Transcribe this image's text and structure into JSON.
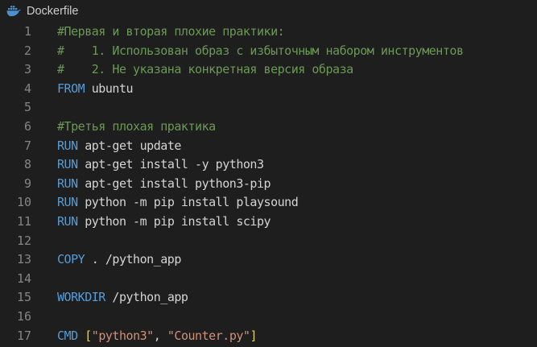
{
  "tab": {
    "filename": "Dockerfile",
    "icon": "docker-icon",
    "icon_color": "#4c8fca"
  },
  "colors": {
    "background": "#1e1e1e",
    "line_number": "#858585",
    "comment": "#6a9955",
    "keyword": "#569cd6",
    "text": "#d4d4d4",
    "string": "#ce9178",
    "bracket": "#ffd700"
  },
  "lines": [
    {
      "number": "1",
      "tokens": [
        {
          "type": "comment",
          "text": "#Первая и вторая плохие практики:"
        }
      ]
    },
    {
      "number": "2",
      "tokens": [
        {
          "type": "comment",
          "text": "#    1. Использован образ с избыточным набором инструментов"
        }
      ]
    },
    {
      "number": "3",
      "tokens": [
        {
          "type": "comment",
          "text": "#    2. Не указана конкретная версия образа"
        }
      ]
    },
    {
      "number": "4",
      "tokens": [
        {
          "type": "keyword",
          "text": "FROM"
        },
        {
          "type": "plain",
          "text": " ubuntu"
        }
      ]
    },
    {
      "number": "5",
      "tokens": []
    },
    {
      "number": "6",
      "tokens": [
        {
          "type": "comment",
          "text": "#Третья плохая практика"
        }
      ]
    },
    {
      "number": "7",
      "tokens": [
        {
          "type": "keyword",
          "text": "RUN"
        },
        {
          "type": "plain",
          "text": " apt-get update"
        }
      ]
    },
    {
      "number": "8",
      "tokens": [
        {
          "type": "keyword",
          "text": "RUN"
        },
        {
          "type": "plain",
          "text": " apt-get install -y python3"
        }
      ]
    },
    {
      "number": "9",
      "tokens": [
        {
          "type": "keyword",
          "text": "RUN"
        },
        {
          "type": "plain",
          "text": " apt-get install python3-pip"
        }
      ]
    },
    {
      "number": "10",
      "tokens": [
        {
          "type": "keyword",
          "text": "RUN"
        },
        {
          "type": "plain",
          "text": " python -m pip install playsound"
        }
      ]
    },
    {
      "number": "11",
      "tokens": [
        {
          "type": "keyword",
          "text": "RUN"
        },
        {
          "type": "plain",
          "text": " python -m pip install scipy"
        }
      ]
    },
    {
      "number": "12",
      "tokens": []
    },
    {
      "number": "13",
      "tokens": [
        {
          "type": "keyword",
          "text": "COPY"
        },
        {
          "type": "plain",
          "text": " . /python_app"
        }
      ]
    },
    {
      "number": "14",
      "tokens": []
    },
    {
      "number": "15",
      "tokens": [
        {
          "type": "keyword",
          "text": "WORKDIR"
        },
        {
          "type": "plain",
          "text": " /python_app"
        }
      ]
    },
    {
      "number": "16",
      "tokens": []
    },
    {
      "number": "17",
      "tokens": [
        {
          "type": "keyword",
          "text": "CMD"
        },
        {
          "type": "plain",
          "text": " "
        },
        {
          "type": "bracket",
          "text": "["
        },
        {
          "type": "string",
          "text": "\"python3\""
        },
        {
          "type": "plain",
          "text": ", "
        },
        {
          "type": "string",
          "text": "\"Counter.py\""
        },
        {
          "type": "bracket",
          "text": "]"
        }
      ]
    }
  ]
}
